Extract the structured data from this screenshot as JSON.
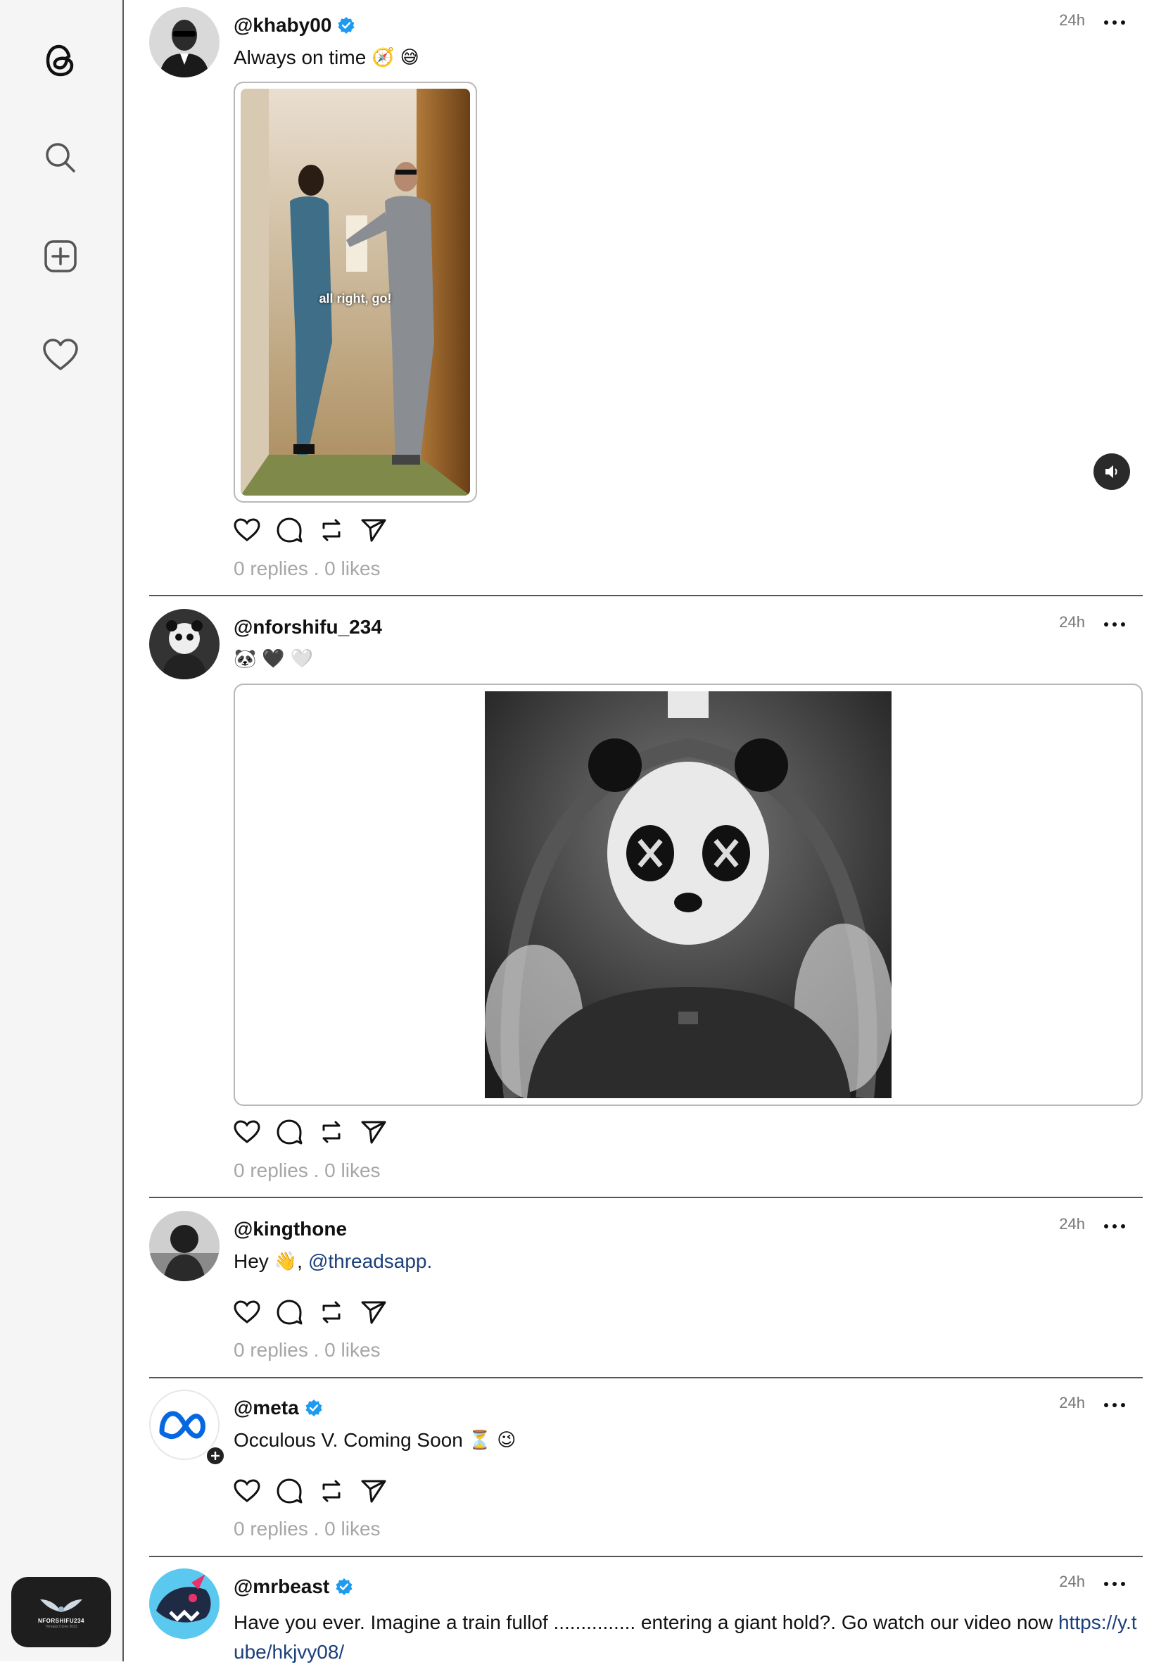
{
  "sidebar": {
    "icons": [
      "threads-logo-icon",
      "search-icon",
      "new-post-icon",
      "heart-icon"
    ],
    "badge": {
      "title": "NFORSHIFU234",
      "subtitle": "Threads Clone 2023"
    }
  },
  "posts": [
    {
      "username": "@khaby00",
      "verified": true,
      "time": "24h",
      "text": "Always on time",
      "emojis": [
        "🧭",
        "😅"
      ],
      "media": {
        "type": "video",
        "caption": "all right, go!"
      },
      "stats": "0 replies . 0 likes"
    },
    {
      "username": "@nforshifu_234",
      "verified": false,
      "time": "24h",
      "text": "",
      "emojis": [
        "🐼",
        "🖤",
        "🤍"
      ],
      "media": {
        "type": "image"
      },
      "stats": "0 replies . 0 likes"
    },
    {
      "username": "@kingthone",
      "verified": false,
      "time": "24h",
      "text": "Hey",
      "emojis": [
        "👋"
      ],
      "text_after": ",",
      "mention": "@threadsapp.",
      "stats": "0 replies . 0 likes"
    },
    {
      "username": "@meta",
      "verified": true,
      "time": "24h",
      "text": "Occulous V. Coming Soon",
      "emojis": [
        "⏳",
        "😉"
      ],
      "stats": "0 replies . 0 likes"
    },
    {
      "username": "@mrbeast",
      "verified": true,
      "time": "24h",
      "text": "Have you ever. Imagine a train fullof ............... entering a giant hold?. Go watch our video now",
      "link": "https://y.tube/hkjvy08/"
    }
  ],
  "colors": {
    "verified": "#1d9bf0",
    "link": "#1b3f7a",
    "stats": "#a6a6a6",
    "sidebar_bg": "#f5f5f5"
  }
}
